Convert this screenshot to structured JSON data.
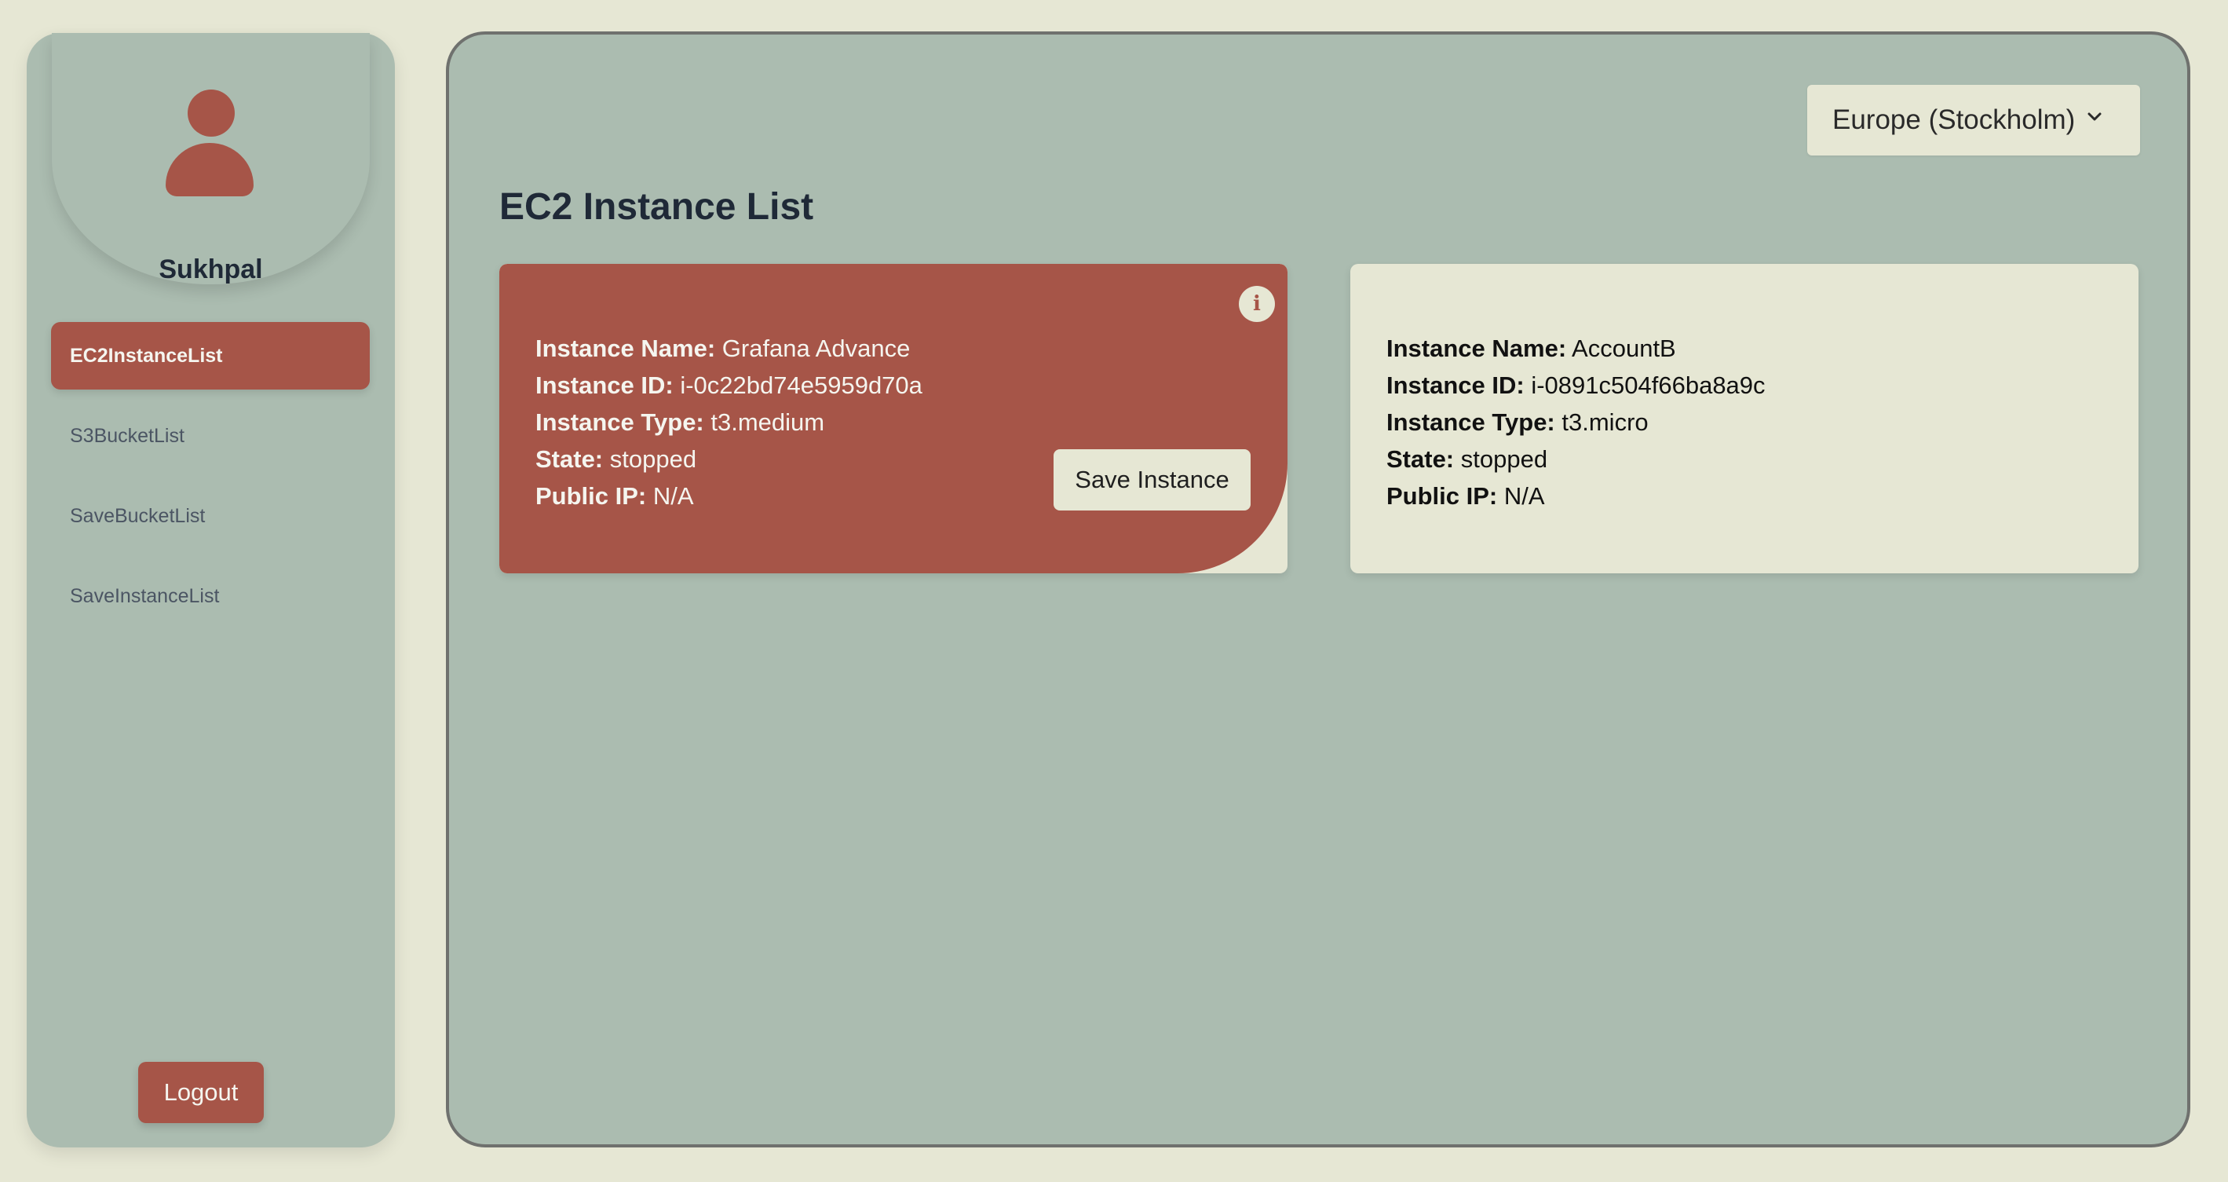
{
  "user": {
    "name": "Sukhpal"
  },
  "sidebar": {
    "items": [
      {
        "label": "EC2InstanceList",
        "active": true
      },
      {
        "label": "S3BucketList",
        "active": false
      },
      {
        "label": "SaveBucketList",
        "active": false
      },
      {
        "label": "SaveInstanceList",
        "active": false
      }
    ],
    "logout_label": "Logout"
  },
  "region": {
    "selected": "Europe (Stockholm)"
  },
  "page": {
    "title": "EC2 Instance List"
  },
  "labels": {
    "name": "Instance Name:",
    "id": "Instance ID:",
    "type": "Instance Type:",
    "state": "State:",
    "ip": "Public IP:"
  },
  "instances": [
    {
      "name": "Grafana Advance",
      "id": "i-0c22bd74e5959d70a",
      "type": "t3.medium",
      "state": "stopped",
      "public_ip": "N/A",
      "save_label": "Save Instance",
      "info_icon": "i"
    },
    {
      "name": "AccountB",
      "id": "i-0891c504f66ba8a9c",
      "type": "t3.micro",
      "state": "stopped",
      "public_ip": "N/A"
    }
  ],
  "colors": {
    "background": "#e6e7d4",
    "panel": "#abbcb0",
    "accent": "#a65548",
    "border": "#6f716e"
  }
}
